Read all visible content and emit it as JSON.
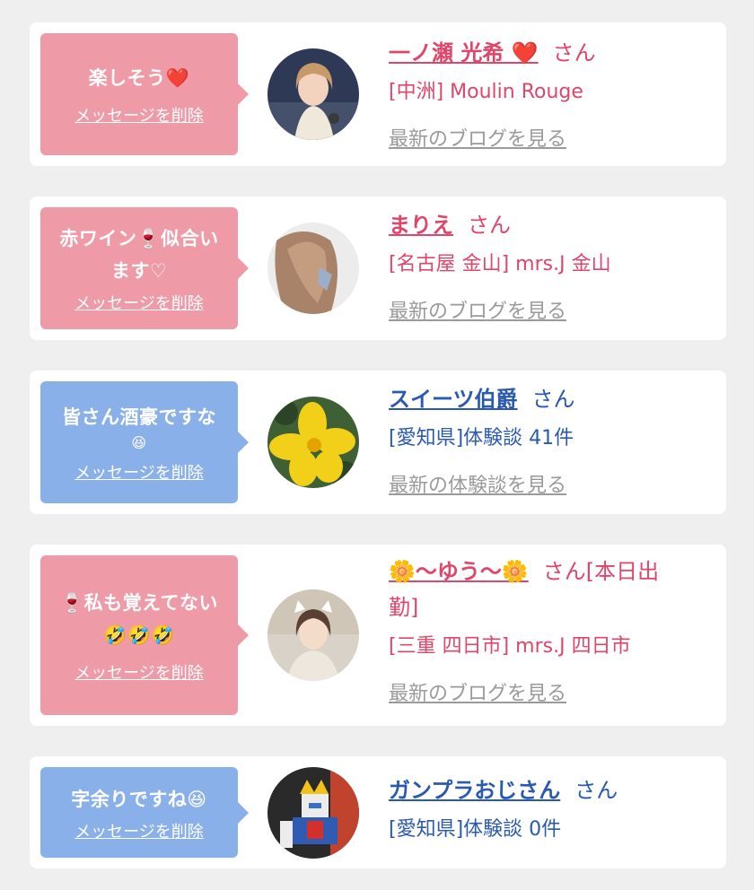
{
  "items": [
    {
      "message": "楽しそう❤️",
      "message2": "",
      "delete_label": "メッセージを削除",
      "name": "一ノ瀬 光希 ❤️",
      "suffix": "さん",
      "shop": "[中洲] Moulin Rouge",
      "link": "最新のブログを見る",
      "theme": "pink"
    },
    {
      "message": "赤ワイン🍷似合い",
      "message2": "ます♡",
      "delete_label": "メッセージを削除",
      "name": "まりえ",
      "suffix": "さん",
      "shop": "[名古屋 金山] mrs.J 金山",
      "link": "最新のブログを見る",
      "theme": "pink"
    },
    {
      "message": "皆さん酒豪ですな",
      "message2": "😆",
      "delete_label": "メッセージを削除",
      "name": "スイーツ伯爵",
      "suffix": "さん",
      "shop": "[愛知県]体験談 41件",
      "link": "最新の体験談を見る",
      "theme": "blue"
    },
    {
      "message": "🍷私も覚えてない",
      "message2": "🤣🤣🤣",
      "delete_label": "メッセージを削除",
      "name": "🌼〜ゆう〜🌼",
      "suffix": "さん[本日出",
      "suffix2": "勤]",
      "shop": "[三重 四日市] mrs.J 四日市",
      "link": "最新のブログを見る",
      "theme": "pink"
    },
    {
      "message": "字余りですね😆",
      "message2": "",
      "delete_label": "メッセージを削除",
      "name": "ガンプラおじさん",
      "suffix": "さん",
      "shop": "[愛知県]体験談 0件",
      "link": "",
      "theme": "blue"
    }
  ]
}
